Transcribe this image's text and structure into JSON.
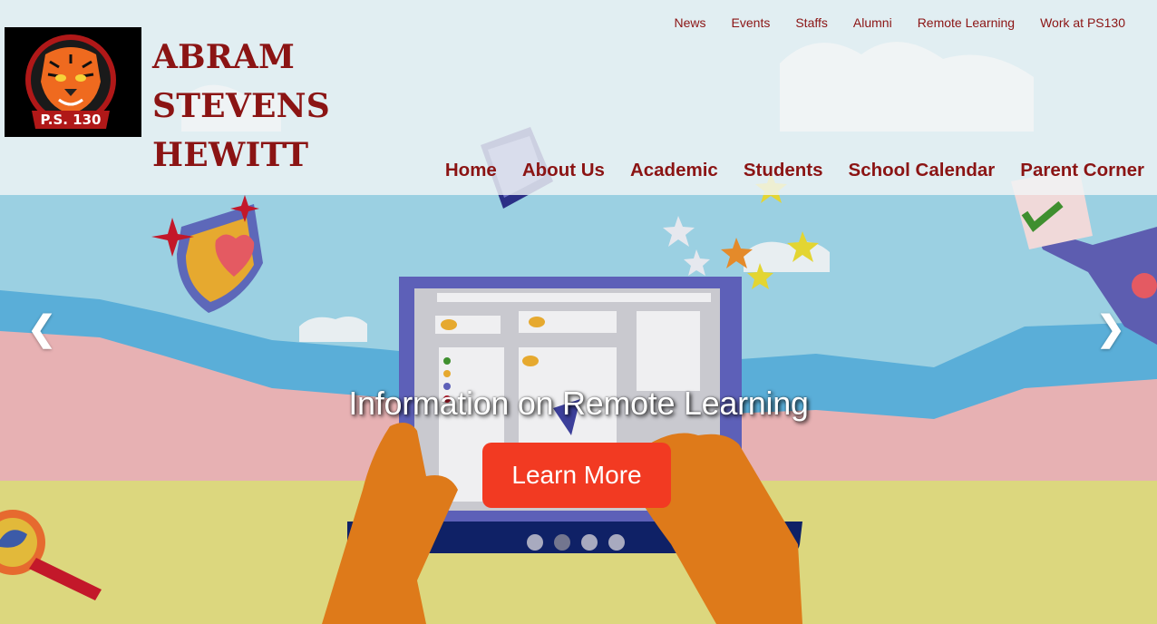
{
  "school": {
    "name_line1": "ABRAM STEVENS",
    "name_line2": "HEWITT",
    "logo_text": "P.S. 130"
  },
  "top_nav": [
    "News",
    "Events",
    "Staffs",
    "Alumni",
    "Remote Learning",
    "Work at PS130"
  ],
  "main_nav": [
    "Home",
    "About Us",
    "Academic",
    "Students",
    "School Calendar",
    "Parent Corner"
  ],
  "slider": {
    "prev_icon": "❮",
    "next_icon": "❯",
    "caption": "Information on Remote Learning",
    "button_label": "Learn More",
    "slide_count": 4,
    "active_slide": 2
  },
  "colors": {
    "brand": "#8b1414",
    "button": "#f23a22",
    "sky": "#9bd0e2",
    "ground": "#dcd77e"
  }
}
